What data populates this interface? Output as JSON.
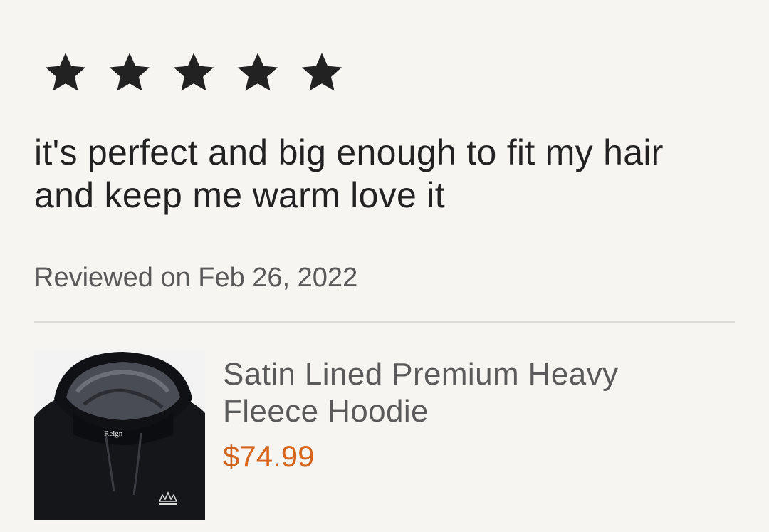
{
  "review": {
    "rating": 5,
    "rating_max": 5,
    "text": "it's perfect and big enough to fit my hair and keep me warm love it",
    "date": "Reviewed on Feb 26, 2022"
  },
  "product": {
    "title": "Satin Lined Premium Heavy Fleece Hoodie",
    "price": "$74.99",
    "image_label": "Reign"
  },
  "colors": {
    "background": "#f6f5f1",
    "star": "#222222",
    "price": "#d5641c"
  },
  "icons": {
    "star": "star-icon"
  }
}
